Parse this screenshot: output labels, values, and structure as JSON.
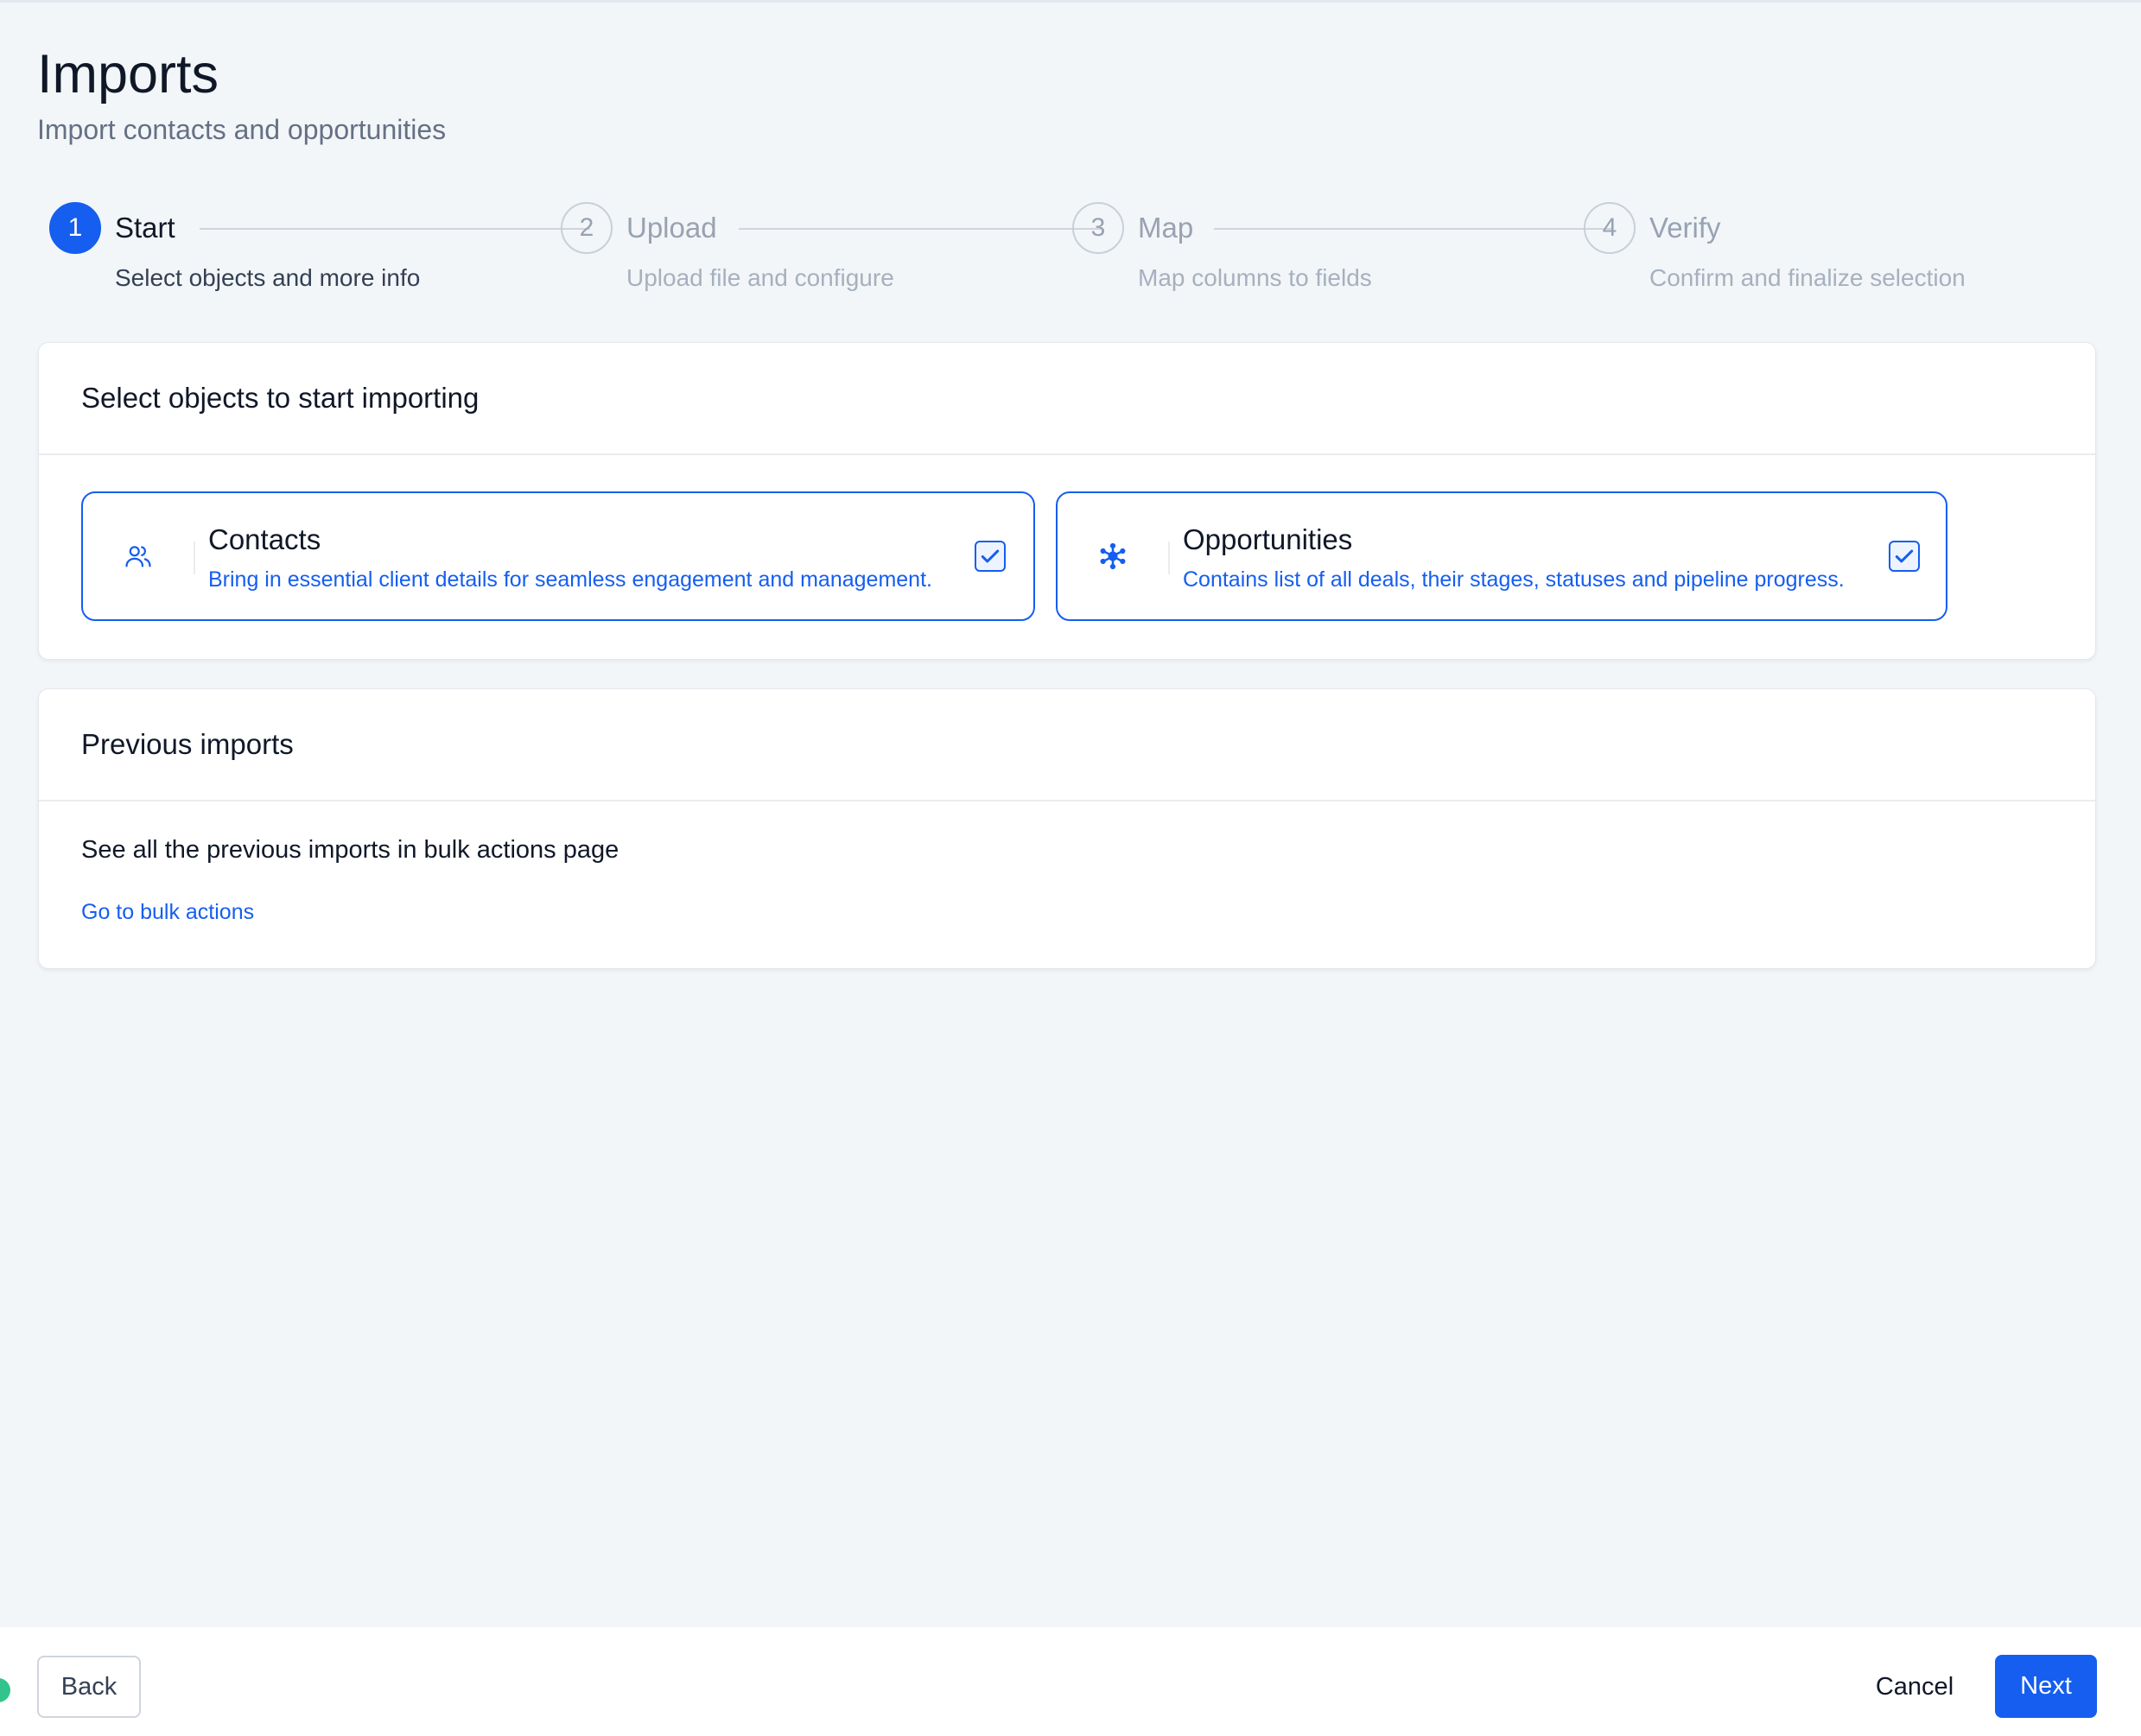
{
  "page": {
    "title": "Imports",
    "subtitle": "Import contacts and opportunities"
  },
  "stepper": {
    "current_step": 1,
    "steps": [
      {
        "number": "1",
        "label": "Start",
        "description": "Select objects and more info"
      },
      {
        "number": "2",
        "label": "Upload",
        "description": "Upload file and configure"
      },
      {
        "number": "3",
        "label": "Map",
        "description": "Map columns to fields"
      },
      {
        "number": "4",
        "label": "Verify",
        "description": "Confirm and finalize selection"
      }
    ]
  },
  "select_objects": {
    "title": "Select objects to start importing",
    "options": [
      {
        "title": "Contacts",
        "description": "Bring in essential client details for seamless engagement and management.",
        "icon": "users-icon",
        "checked": true
      },
      {
        "title": "Opportunities",
        "description": "Contains list of all deals, their stages, statuses and pipeline progress.",
        "icon": "network-icon",
        "checked": true
      }
    ]
  },
  "previous_imports": {
    "title": "Previous imports",
    "text": "See all the previous imports in bulk actions page",
    "link_label": "Go to bulk actions"
  },
  "footer": {
    "back_label": "Back",
    "cancel_label": "Cancel",
    "next_label": "Next"
  },
  "colors": {
    "primary": "#155eef",
    "background": "#f2f6f8",
    "status_dot": "#31c48d"
  }
}
